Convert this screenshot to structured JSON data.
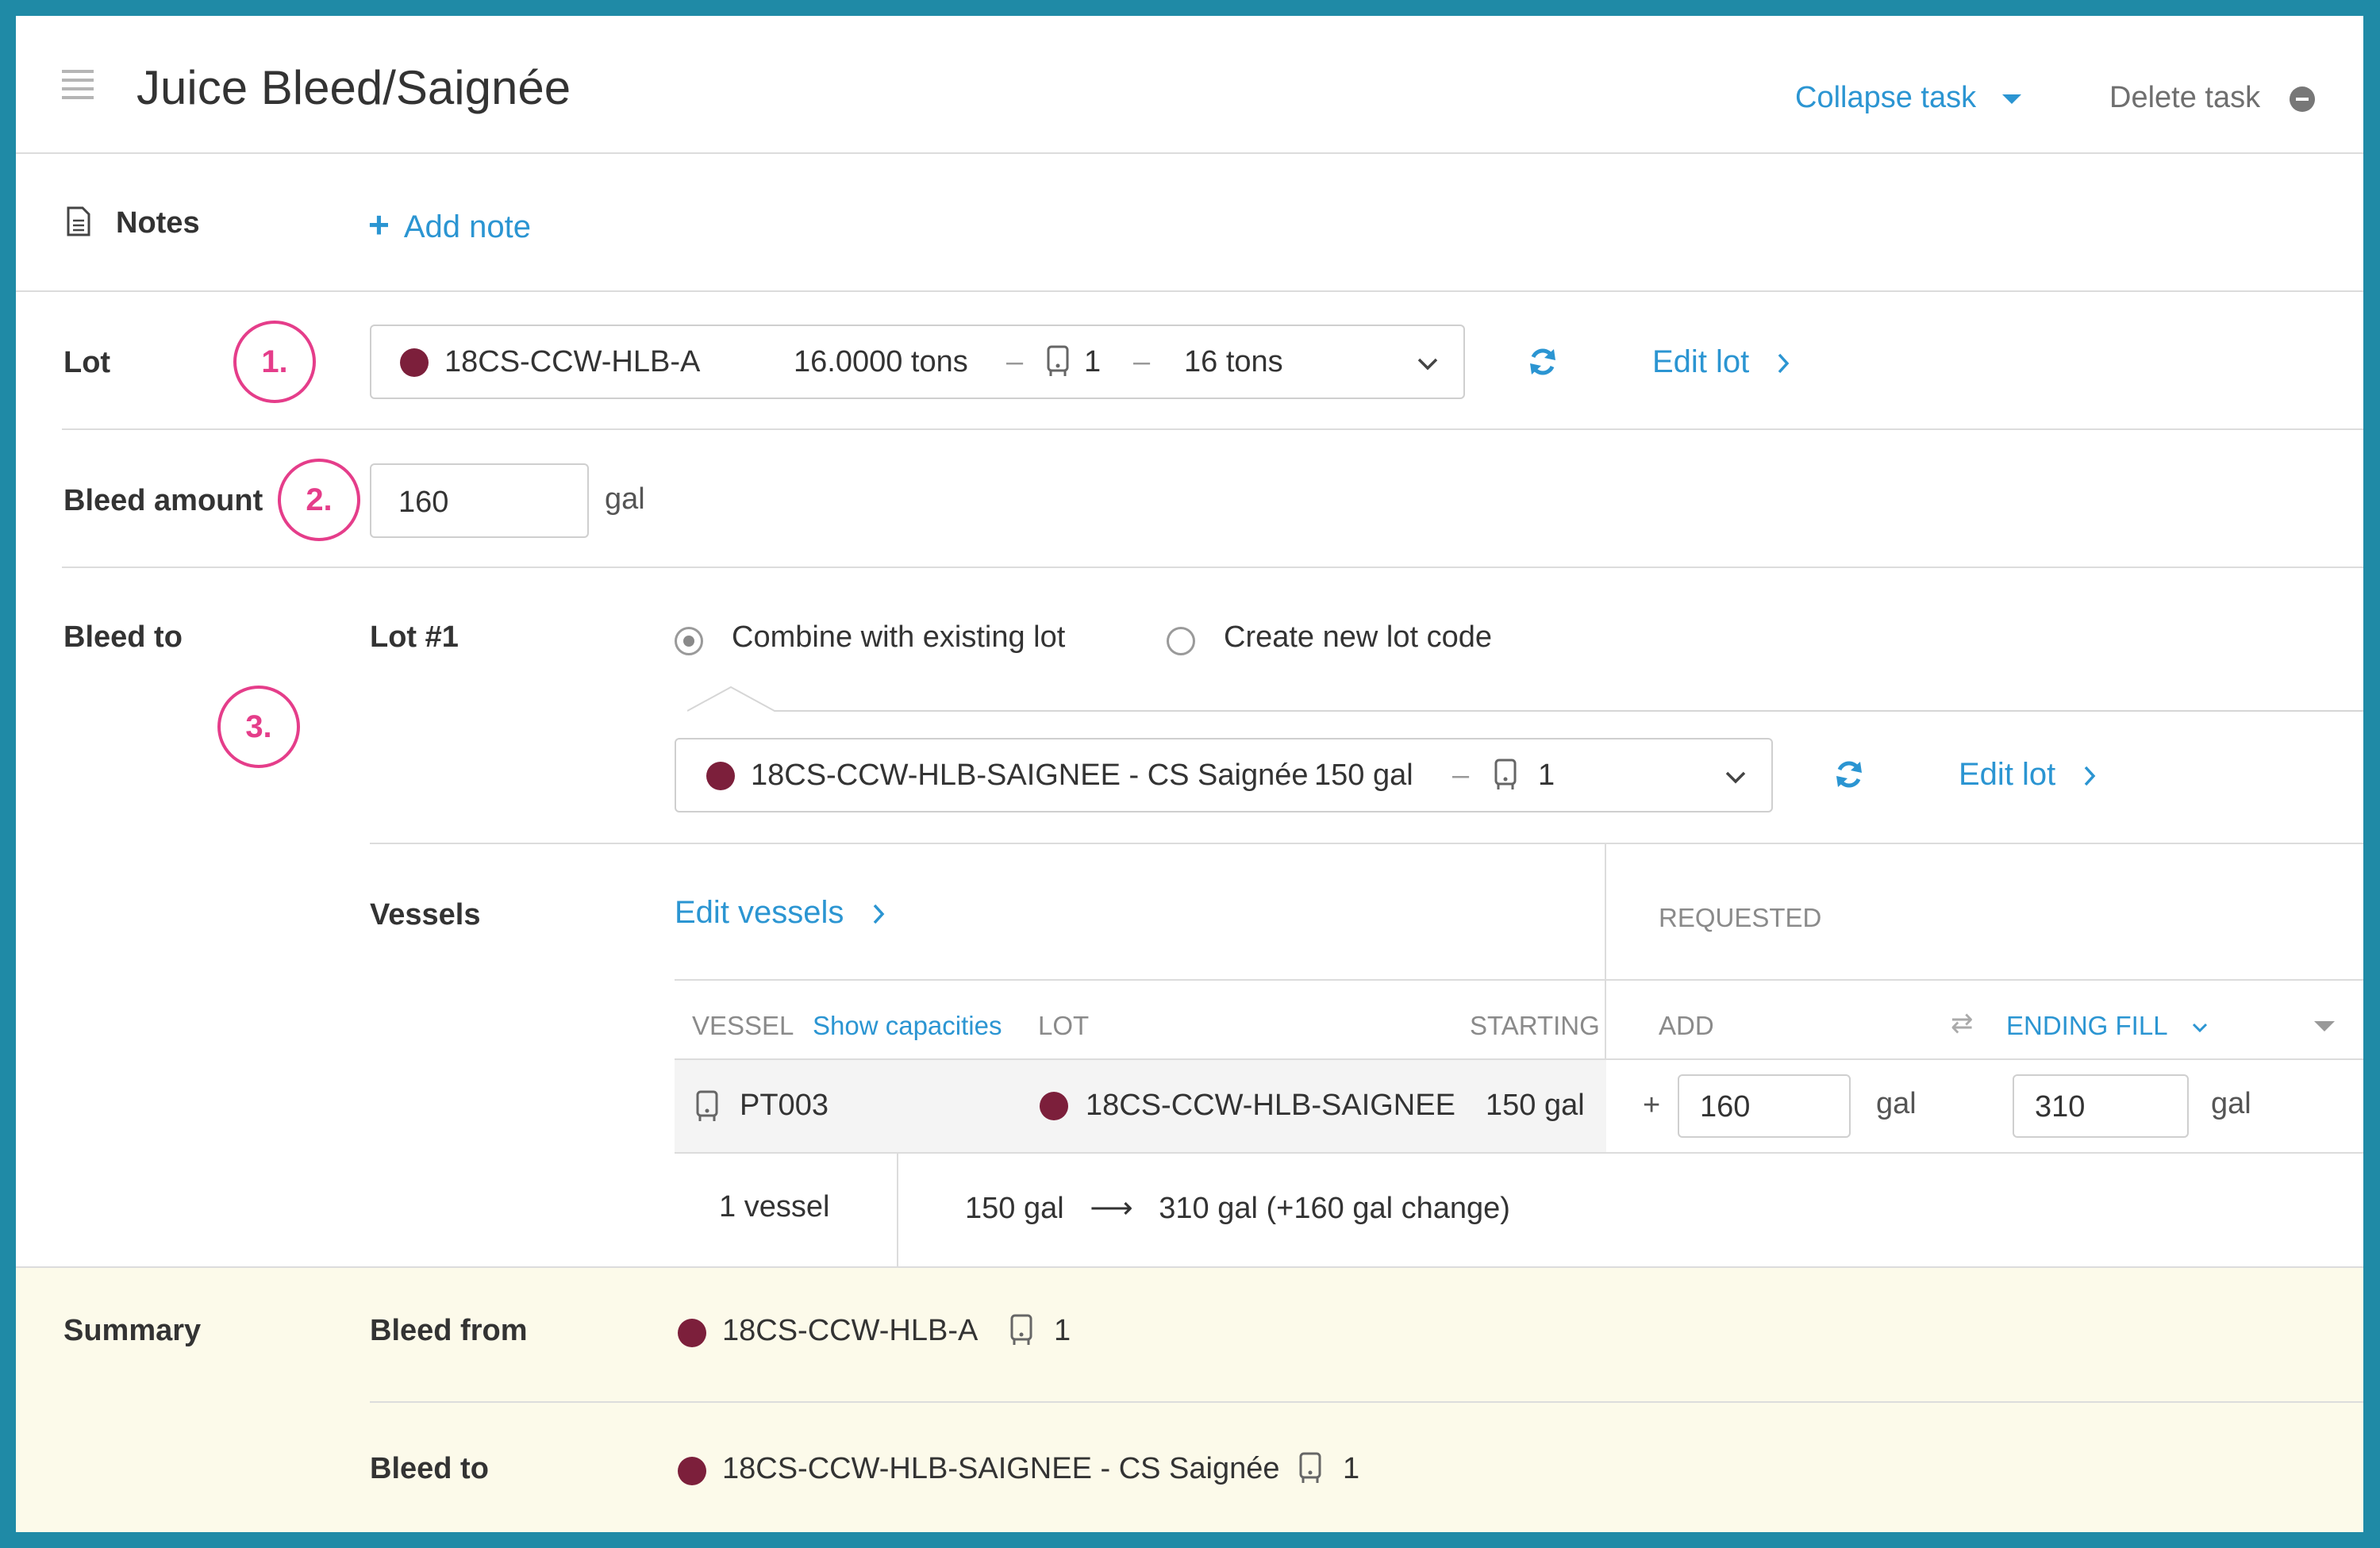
{
  "header": {
    "title": "Juice Bleed/Saignée",
    "collapse_label": "Collapse task",
    "delete_label": "Delete task"
  },
  "notes": {
    "label": "Notes",
    "add_label": "Add note"
  },
  "lot": {
    "label": "Lot",
    "badge": "1.",
    "code": "18CS-CCW-HLB-A",
    "weight": "16.0000 tons",
    "dash": "–",
    "vessel_count": "1",
    "amount": "16 tons",
    "edit_label": "Edit lot"
  },
  "bleed_amount": {
    "label": "Bleed amount",
    "badge": "2.",
    "value": "160",
    "unit": "gal"
  },
  "bleed_to": {
    "label": "Bleed to",
    "badge": "3.",
    "lot_label": "Lot #1",
    "option_combine": "Combine with existing lot",
    "option_new": "Create new lot code",
    "selected_option": "combine",
    "target_lot": "18CS-CCW-HLB-SAIGNEE - CS Saignée",
    "target_volume": "150 gal",
    "target_dash": "–",
    "target_vessel_count": "1",
    "edit_label": "Edit lot"
  },
  "vessels": {
    "label": "Vessels",
    "edit_label": "Edit vessels",
    "requested_label": "REQUESTED",
    "columns": {
      "vessel": "VESSEL",
      "show_capacities": "Show capacities",
      "lot": "LOT",
      "starting": "STARTING",
      "add": "ADD",
      "ending_fill": "ENDING FILL"
    },
    "rows": [
      {
        "vessel": "PT003",
        "lot": "18CS-CCW-HLB-SAIGNEE",
        "starting": "150 gal",
        "plus": "+",
        "add_value": "160",
        "add_unit": "gal",
        "ending_value": "310",
        "ending_unit": "gal"
      }
    ],
    "footer_count": "1 vessel",
    "footer_from": "150 gal",
    "footer_to": "310 gal (+160 gal change)"
  },
  "summary": {
    "label": "Summary",
    "from_label": "Bleed from",
    "from_lot": "18CS-CCW-HLB-A",
    "from_count": "1",
    "to_label": "Bleed to",
    "to_lot": "18CS-CCW-HLB-SAIGNEE - CS Saignée",
    "to_count": "1"
  },
  "colors": {
    "accent": "#2b95d2",
    "lot_dot": "#7c1f3b",
    "badge": "#e53d8a",
    "summary_bg": "#fcfaea",
    "frame": "#1f8aa6"
  }
}
